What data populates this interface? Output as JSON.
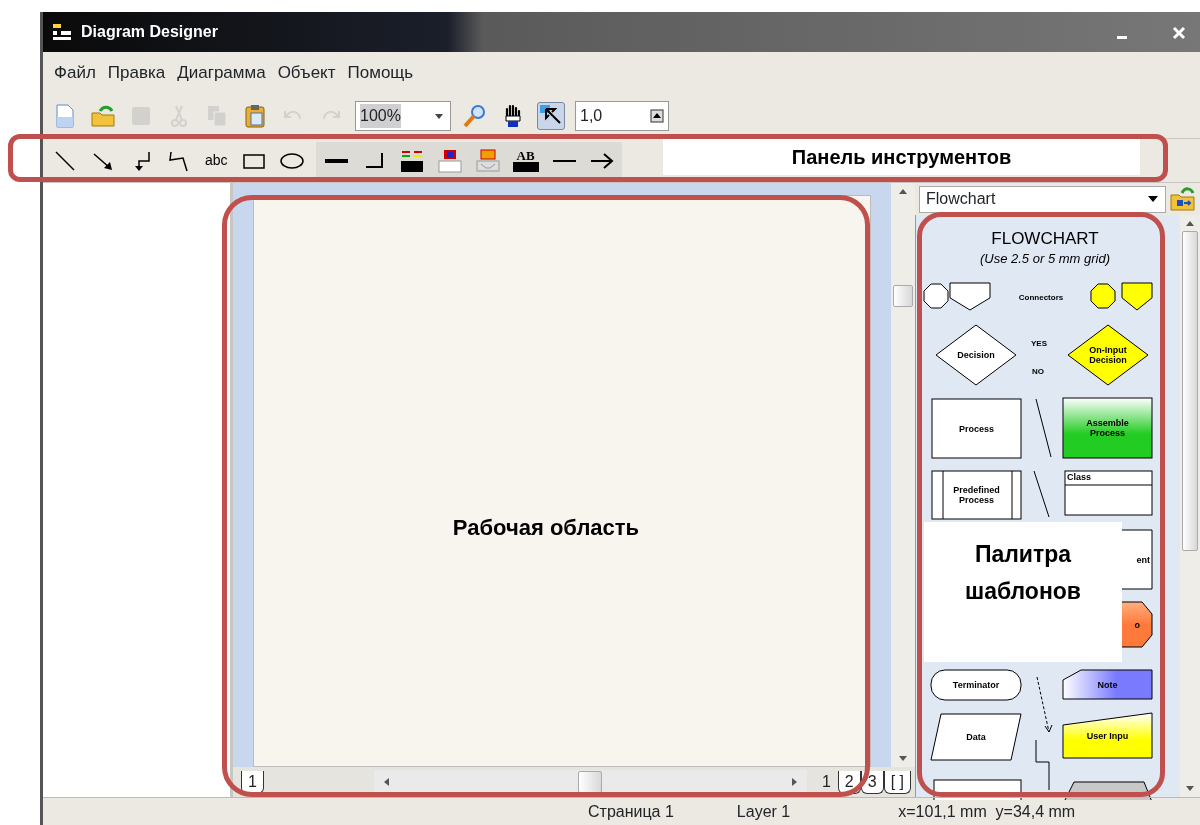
{
  "window": {
    "title": "Diagram Designer"
  },
  "menu": [
    {
      "label": "Файл"
    },
    {
      "label": "Правка"
    },
    {
      "label": "Диаграмма"
    },
    {
      "label": "Объект"
    },
    {
      "label": "Помощь"
    }
  ],
  "toolbar_1": [
    {
      "kind": "new",
      "disabled": false,
      "pressed": false
    },
    {
      "kind": "open",
      "disabled": false,
      "pressed": false
    },
    {
      "kind": "save",
      "disabled": true,
      "pressed": false
    },
    {
      "kind": "cut",
      "disabled": true,
      "pressed": false
    },
    {
      "kind": "copy",
      "disabled": true,
      "pressed": false
    },
    {
      "kind": "paste",
      "disabled": false,
      "pressed": false
    },
    {
      "kind": "undo",
      "disabled": true,
      "pressed": false
    },
    {
      "kind": "redo",
      "disabled": true,
      "pressed": false
    },
    {
      "kind": "zoom_combo",
      "value": "100%",
      "disabled": false,
      "pressed": false
    },
    {
      "kind": "zoom",
      "disabled": false,
      "pressed": false
    },
    {
      "kind": "hand",
      "disabled": false,
      "pressed": false
    },
    {
      "kind": "pointer",
      "disabled": false,
      "pressed": true
    },
    {
      "kind": "spin",
      "value": "1,0",
      "disabled": false,
      "pressed": false
    }
  ],
  "toolbar_2": [
    {
      "kind": "line"
    },
    {
      "kind": "arrow"
    },
    {
      "kind": "elbow"
    },
    {
      "kind": "polyline"
    },
    {
      "kind": "text_tool",
      "label": "abc"
    },
    {
      "kind": "rect"
    },
    {
      "kind": "ellipse"
    },
    {
      "kind": "line_width"
    },
    {
      "kind": "corner"
    },
    {
      "kind": "line_color"
    },
    {
      "kind": "fill_color"
    },
    {
      "kind": "gradient"
    },
    {
      "kind": "font_color",
      "label": "AB"
    },
    {
      "kind": "line_style"
    },
    {
      "kind": "arrow_end"
    }
  ],
  "page_tabs_left": [
    {
      "label": "1"
    }
  ],
  "page_tabs_right": [
    {
      "label": "1",
      "selected": true
    },
    {
      "label": "2",
      "selected": false
    },
    {
      "label": "3",
      "selected": false
    },
    {
      "label": "[ ]",
      "selected": false
    }
  ],
  "palette": {
    "selector": "Flowchart",
    "title": "FLOWCHART",
    "subtitle": "(Use 2.5 or 5 mm grid)",
    "shapes": [
      {
        "kind": "octagon",
        "color": "#ffffff"
      },
      {
        "kind": "pentagon",
        "color": "#ffffff"
      },
      {
        "kind": "caption",
        "label": "Connectors"
      },
      {
        "kind": "octagon",
        "color": "#ffff00"
      },
      {
        "kind": "pentagon",
        "color": "#ffff00"
      },
      {
        "kind": "diamond",
        "label": "Decision",
        "color": "#ffffff"
      },
      {
        "kind": "caption",
        "label": "YES"
      },
      {
        "kind": "caption",
        "label": "NO"
      },
      {
        "kind": "diamond",
        "label": "On-Input Decision",
        "color": "#ffff00"
      },
      {
        "kind": "rect",
        "label": "Process",
        "color": "#ffffff"
      },
      {
        "kind": "line"
      },
      {
        "kind": "rect",
        "label": "Assemble Process",
        "color": "#22cc22"
      },
      {
        "kind": "predefined",
        "label": "Predefined Process",
        "color": "#ffffff"
      },
      {
        "kind": "line"
      },
      {
        "kind": "class",
        "label": "Class",
        "color": "#ffffff"
      },
      {
        "kind": "rect",
        "label": "ent",
        "color": "#ffffff"
      },
      {
        "kind": "octagon_wide",
        "label": "o",
        "color": "#ff7a3a"
      },
      {
        "kind": "terminator",
        "label": "Terminator",
        "color": "#ffffff"
      },
      {
        "kind": "dashed_arrow"
      },
      {
        "kind": "note",
        "label": "Note",
        "color": "#7a7aff"
      },
      {
        "kind": "data",
        "label": "Data",
        "color": "#ffffff"
      },
      {
        "kind": "step_line"
      },
      {
        "kind": "user_input",
        "label": "User Inpu",
        "color": "#ffff00"
      },
      {
        "kind": "rect",
        "color": "#ffffff"
      },
      {
        "kind": "trapezoid",
        "color": "#c8c8c8"
      }
    ]
  },
  "status_bar": {
    "page": "Страница 1",
    "layer": "Layer 1",
    "coords": "x=101,1 mm  y=34,4 mm"
  },
  "annotations": [
    {
      "kind": "toolbar",
      "label": "Панель инструментов"
    },
    {
      "kind": "workspace",
      "label": "Рабочая область"
    },
    {
      "kind": "palette",
      "label": "Палитра шаблонов"
    }
  ]
}
